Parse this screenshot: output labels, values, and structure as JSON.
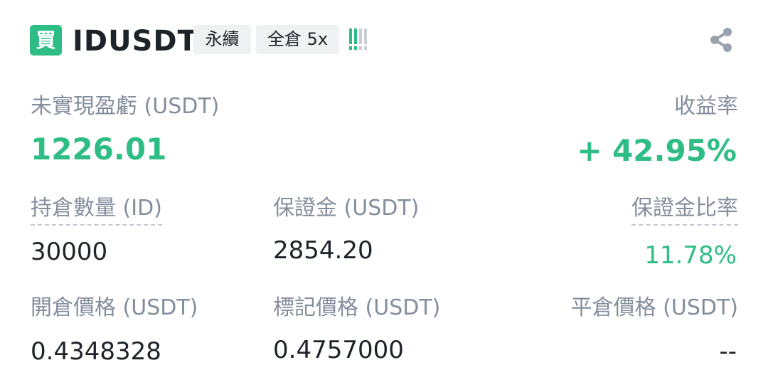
{
  "header": {
    "side_label": "買",
    "symbol": "IDUSDT",
    "contract_type": "永續",
    "margin_mode": "全倉 5x",
    "risk_icon": "risk-level-bars-icon",
    "share_icon": "share-icon"
  },
  "pnl": {
    "label": "未實現盈虧 (USDT)",
    "value": "1226.01",
    "roe_label": "收益率",
    "roe_value": "+ 42.95%"
  },
  "row1": {
    "size_label": "持倉數量 (ID)",
    "size_value": "30000",
    "margin_label": "保證金 (USDT)",
    "margin_value": "2854.20",
    "margin_ratio_label": "保證金比率",
    "margin_ratio_value": "11.78%"
  },
  "row2": {
    "entry_label": "開倉價格 (USDT)",
    "entry_value": "0.4348328",
    "mark_label": "標記價格 (USDT)",
    "mark_value": "0.4757000",
    "liq_label": "平倉價格 (USDT)",
    "liq_value": "--"
  },
  "colors": {
    "green": "#2ebd85",
    "label_gray": "#848e9c",
    "text": "#1e2329",
    "tag_bg": "#f0f1f2"
  }
}
